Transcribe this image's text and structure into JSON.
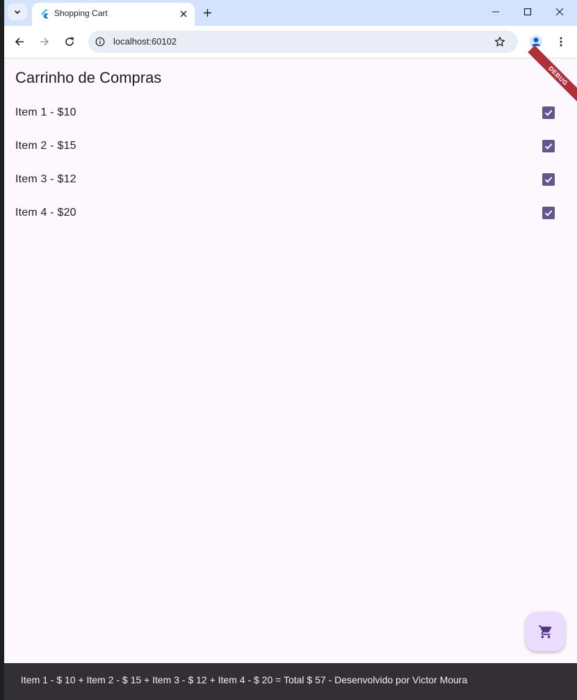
{
  "browser": {
    "tab_title": "Shopping Cart",
    "url": "localhost:60102"
  },
  "app": {
    "title": "Carrinho de Compras",
    "debug_banner": "DEBUG",
    "items": [
      {
        "label": "Item 1 - $10",
        "checked": true
      },
      {
        "label": "Item 2 - $15",
        "checked": true
      },
      {
        "label": "Item 3 - $12",
        "checked": true
      },
      {
        "label": "Item 4 - $20",
        "checked": true
      }
    ],
    "fab_icon": "shopping-cart-icon",
    "snackbar_text": "Item 1 - $ 10 + Item 2 - $ 15 + Item 3 - $ 12 + Item 4 - $ 20 = Total $ 57 - Desenvolvido por Victor Moura"
  },
  "colors": {
    "accent": "#65558f",
    "page_bg": "#fdf7fe",
    "fab_bg": "#eaddff",
    "snackbar_bg": "#322f35",
    "tabstrip_bg": "#d3e3fd"
  }
}
